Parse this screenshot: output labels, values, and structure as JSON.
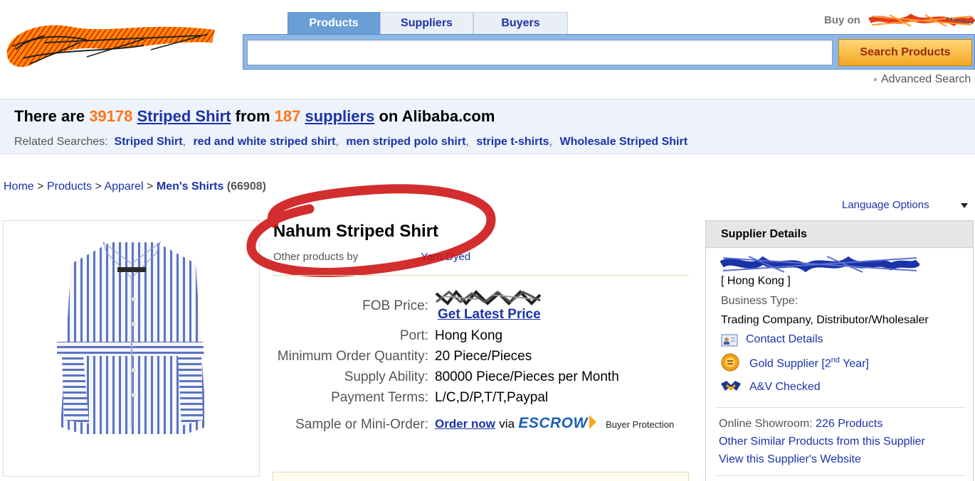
{
  "header": {
    "tabs": [
      {
        "label": "Products",
        "active": true
      },
      {
        "label": "Suppliers",
        "active": false
      },
      {
        "label": "Buyers",
        "active": false
      }
    ],
    "search": {
      "value": "",
      "placeholder": ""
    },
    "search_button": "Search Products",
    "buy_on_label": "Buy on",
    "advanced_search": "Advanced Search"
  },
  "banner": {
    "prefix": "There are",
    "count": "39178",
    "keyword": "Striped Shirt",
    "from": "from",
    "supplier_count": "187",
    "suppliers_link": "suppliers",
    "suffix": "on Alibaba.com",
    "related_label": "Related Searches:",
    "related": [
      "Striped Shirt",
      "red and white striped shirt",
      "men striped polo shirt",
      "stripe t-shirts",
      "Wholesale Striped Shirt"
    ]
  },
  "breadcrumb": {
    "home": "Home",
    "products": "Products",
    "apparel": "Apparel",
    "category": "Men's Shirts",
    "category_count": "(66908)",
    "sep": ">"
  },
  "language_options": "Language Options",
  "product": {
    "title": "Nahum Striped Shirt",
    "other_products_prefix": "Other products by",
    "other_products_link": "Yarn Dyed",
    "specs": [
      {
        "label": "FOB Price:",
        "value": ""
      },
      {
        "label": "Port:",
        "value": "Hong Kong"
      },
      {
        "label": "Minimum Order Quantity:",
        "value": "20 Piece/Pieces"
      },
      {
        "label": "Supply Ability:",
        "value": "80000 Piece/Pieces per Month"
      },
      {
        "label": "Payment Terms:",
        "value": "L/C,D/P,T/T,Paypal"
      },
      {
        "label": "Sample or Mini-Order:",
        "value": ""
      }
    ],
    "get_latest_price": "Get Latest Price",
    "order_now": "Order now",
    "via": "via",
    "escrow": "ESCROW",
    "buyer_protection": "Buyer Protection"
  },
  "supplier": {
    "heading": "Supplier Details",
    "location": "[ Hong Kong ]",
    "business_type_label": "Business Type:",
    "business_type": "Trading Company, Distributor/Wholesaler",
    "contact_details": "Contact Details",
    "gold_supplier": "Gold Supplier [2",
    "gold_supplier_sup": "nd",
    "gold_supplier_end": " Year]",
    "av_checked": "A&V Checked",
    "online_showroom_label": "Online Showroom:",
    "online_showroom_value": "226 Products",
    "other_similar": "Other Similar Products from this Supplier",
    "view_website": "View this Supplier's Website"
  },
  "colors": {
    "link_blue": "#1a33a8",
    "accent_orange": "#ff7519",
    "tab_active": "#6a9fd6",
    "search_bar": "#8db8e6",
    "search_button": "#f5a722",
    "annotation_red": "#cc1111"
  }
}
